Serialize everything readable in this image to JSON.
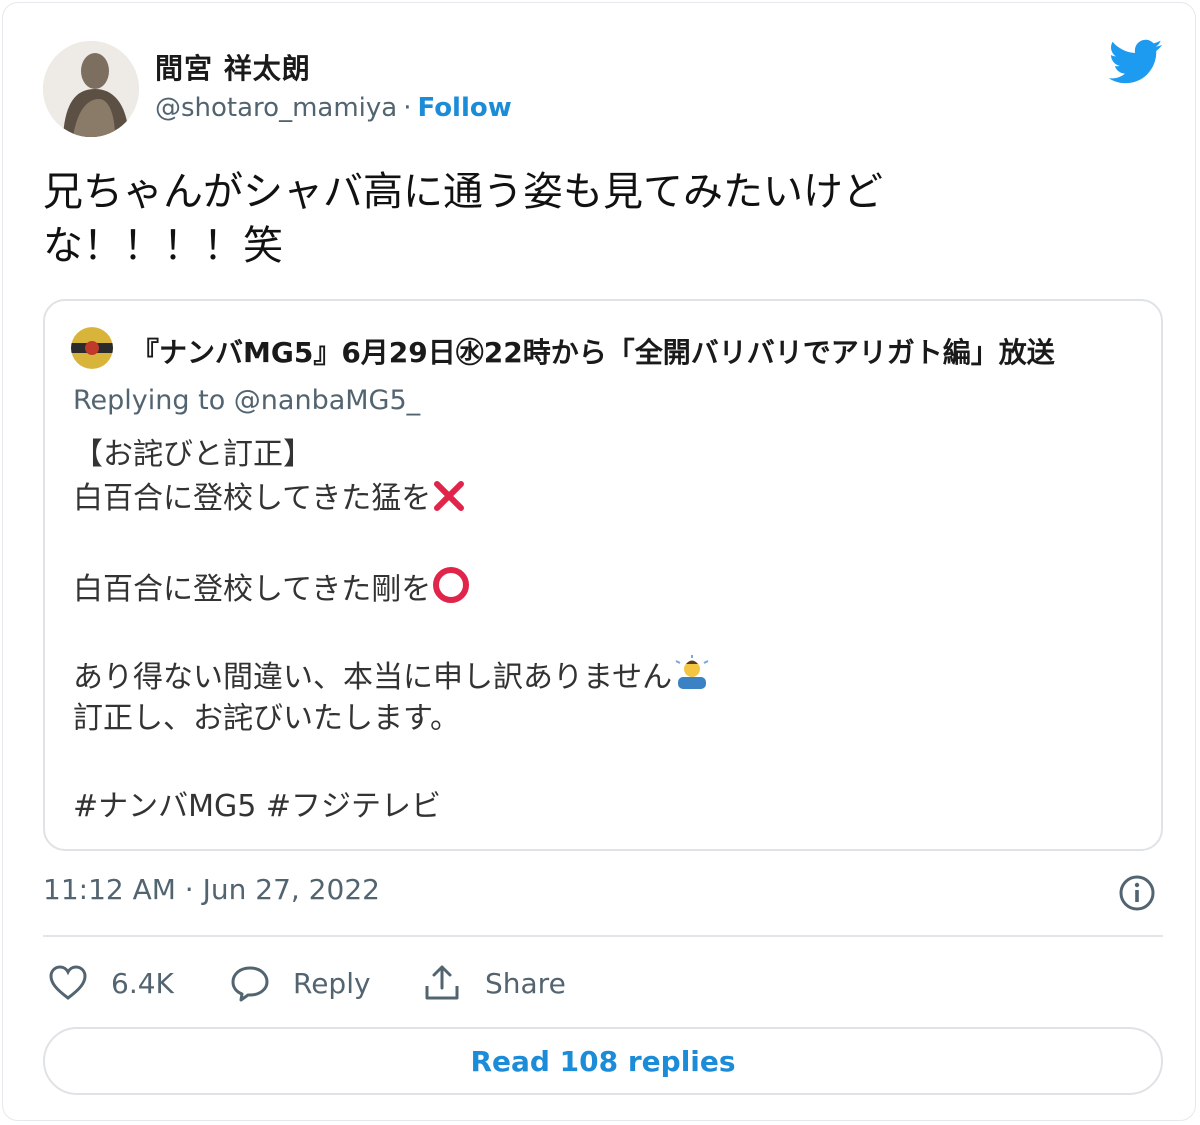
{
  "author": {
    "display_name": "間宮 祥太朗",
    "handle": "@shotaro_mamiya",
    "separator": "·",
    "follow_label": "Follow"
  },
  "tweet": {
    "text_lines": [
      "兄ちゃんがシャバ高に通う姿も見てみたいけど",
      "な！！！！笑"
    ]
  },
  "quoted": {
    "author_name": "『ナンバMG5』6月29日㊌22時から「全開バリバリでアリガト編」放送",
    "replying_to": "Replying to @nanbaMG5_",
    "lines": {
      "l1": "【お詫びと訂正】",
      "l2": "白百合に登校してきた猛を",
      "l3": "白百合に登校してきた剛を",
      "l4": "あり得ない間違い、本当に申し訳ありません",
      "l5": "訂正し、お詫びいたします。",
      "l6": "#ナンバMG5 #フジテレビ"
    }
  },
  "meta": {
    "timestamp": "11:12 AM · Jun 27, 2022"
  },
  "actions": {
    "like_count": "6.4K",
    "reply_label": "Reply",
    "share_label": "Share"
  },
  "read_replies": "Read 108 replies",
  "colors": {
    "accent": "#1d9bf0",
    "follow": "#1d8cd8",
    "muted_text": "#536471",
    "border": "#dfe3e6",
    "cross": "#e0244a"
  },
  "icons": [
    "twitter-bird-icon",
    "heart-icon",
    "reply-bubble-icon",
    "share-icon",
    "info-icon",
    "cross-mark-icon",
    "circle-mark-icon",
    "bowing-person-icon"
  ]
}
